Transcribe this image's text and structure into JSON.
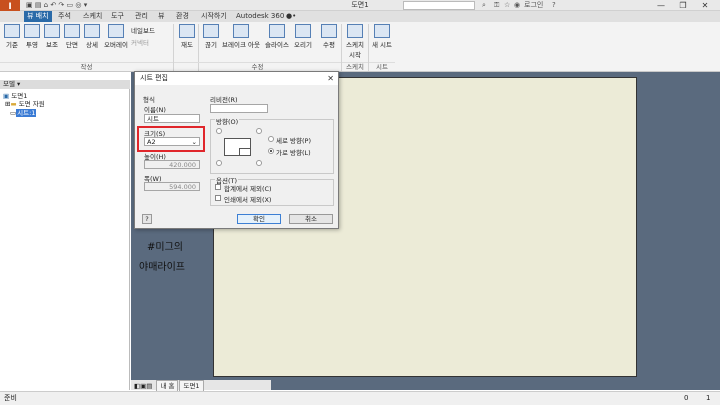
{
  "app": {
    "logo_text": "I",
    "logo_sub": "PRO",
    "document_title": "도면1",
    "search_placeholder": "",
    "user_label": "로그인",
    "window_buttons": [
      "—",
      "❐",
      "✕"
    ]
  },
  "ribbon_tabs": [
    "파일",
    "뷰 배치",
    "주석",
    "스케치",
    "도구",
    "관리",
    "뷰",
    "환경",
    "시작하기",
    "Autodesk 360",
    "●•"
  ],
  "active_tab_index": 1,
  "ribbon": {
    "buttons": [
      "기준",
      "투영",
      "보조",
      "단면",
      "상세",
      "오버레이",
      "네일보드",
      "커넥터",
      "재도",
      "끊기",
      "브레이크 아웃",
      "슬라이스",
      "오리기",
      "수평",
      "스케치 시작",
      "새 시트"
    ],
    "groups": [
      "작성",
      "수정",
      "스케치",
      "시트"
    ]
  },
  "browser": {
    "header": "모델 ▾",
    "items": [
      "도면1",
      "도면 자원",
      "시트:1"
    ]
  },
  "canvas": {
    "watermark_line1": "#미그의",
    "watermark_line2": "야매라이프"
  },
  "sheet_tabs": [
    "내 홈",
    "도면1"
  ],
  "status": {
    "left": "준비",
    "right_a": "0",
    "right_b": "1"
  },
  "dialog": {
    "title": "시트 편집",
    "close": "✕",
    "format_label": "형식",
    "name_label": "이름(N)",
    "name_value": "시트",
    "size_label": "크기(S)",
    "size_value": "A2",
    "height_label": "높이(H)",
    "height_value": "420.000",
    "width_label": "폭(W)",
    "width_value": "594.000",
    "revision_label": "리비전(R)",
    "revision_value": "",
    "orientation_label": "방향(O)",
    "orientation_portrait": "세로 방향(P)",
    "orientation_landscape": "가로 방향(L)",
    "options_label": "옵션(T)",
    "option_exclude_count": "합계에서 제외(C)",
    "option_exclude_print": "인쇄에서 제외(X)",
    "ok_label": "확인",
    "cancel_label": "취소",
    "help_icon_text": "?"
  },
  "colors": {
    "accent_tab": "#2a6aa8",
    "logo": "#c8501e",
    "canvas_bg": "#5a6a7e",
    "sheet_bg": "#ecebd7",
    "highlight": "#e0262b"
  }
}
